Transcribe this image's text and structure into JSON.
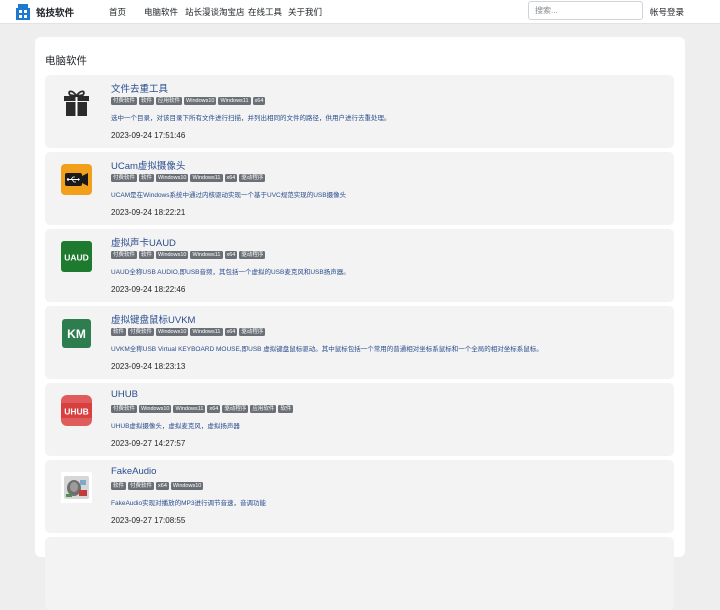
{
  "nav": {
    "brand": "铭技软件",
    "links": [
      "首页",
      "电脑软件",
      "站长漫谈淘宝店",
      "在线工具",
      "关于我们"
    ],
    "search_placeholder": "搜索...",
    "login": "帐号登录"
  },
  "section": {
    "title": "电脑软件"
  },
  "items": [
    {
      "icon": "gift-icon",
      "title": "文件去重工具",
      "tags": [
        "付费软件",
        "软件",
        "应用软件",
        "Windows10",
        "Windows11",
        "x64"
      ],
      "desc": "选中一个目录，对该目录下所有文件进行扫描，并列出相同的文件的路径，供用户进行去重处理。",
      "date": "2023-09-24 17:51:46"
    },
    {
      "icon": "usb-camera-icon",
      "title": "UCam虚拟摄像头",
      "tags": [
        "付费软件",
        "软件",
        "Windows10",
        "Windows11",
        "x64",
        "驱动程序"
      ],
      "desc": "UCAM是在Windows系统中通过内核驱动实现一个基于UVC规范实现的USB摄像头",
      "date": "2023-09-24 18:22:21"
    },
    {
      "icon": "uaud-icon",
      "icon_text": "UAUD",
      "title": "虚拟声卡UAUD",
      "tags": [
        "付费软件",
        "软件",
        "Windows10",
        "Windows11",
        "x64",
        "驱动程序"
      ],
      "desc": "UAUD全称USB AUDIO,即USB音频，其包括一个虚拟的USB麦克风和USB扬声器。",
      "date": "2023-09-24 18:22:46"
    },
    {
      "icon": "km-icon",
      "icon_text": "KM",
      "title": "虚拟键盘鼠标UVKM",
      "tags": [
        "软件",
        "付费软件",
        "Windows10",
        "Windows11",
        "x64",
        "驱动程序"
      ],
      "desc": "UVKM全称USB Virtual KEYBOARD MOUSE,即USB 虚拟键盘鼠标驱动。其中鼠标包括一个常用的普通相对坐标系鼠标和一个全局的相对坐标系鼠标。",
      "date": "2023-09-24 18:23:13"
    },
    {
      "icon": "uhub-icon",
      "icon_text": "UHUB",
      "title": "UHUB",
      "tags": [
        "付费软件",
        "Windows10",
        "Windows11",
        "x64",
        "驱动程序",
        "应用软件",
        "软件"
      ],
      "desc": "UHUB虚拟摄像头，虚拟麦克风，虚拟扬声器",
      "date": "2023-09-27 14:27:57"
    },
    {
      "icon": "fakeaudio-icon",
      "title": "FakeAudio",
      "tags": [
        "软件",
        "付费软件",
        "x64",
        "Windows10"
      ],
      "desc": "FakeAudio实现对播放的MP3进行调节音速，音调功能",
      "date": "2023-09-27 17:08:55"
    }
  ],
  "colors": {
    "link": "#2a4d8f",
    "tag_bg": "#6b7077",
    "uaud_bg": "#1e7a2e",
    "km_bg": "#2e7d4f",
    "uhub_bg": "#e05c5c",
    "camera_bg": "#f2a01b",
    "brand_blue": "#1e78d0"
  }
}
